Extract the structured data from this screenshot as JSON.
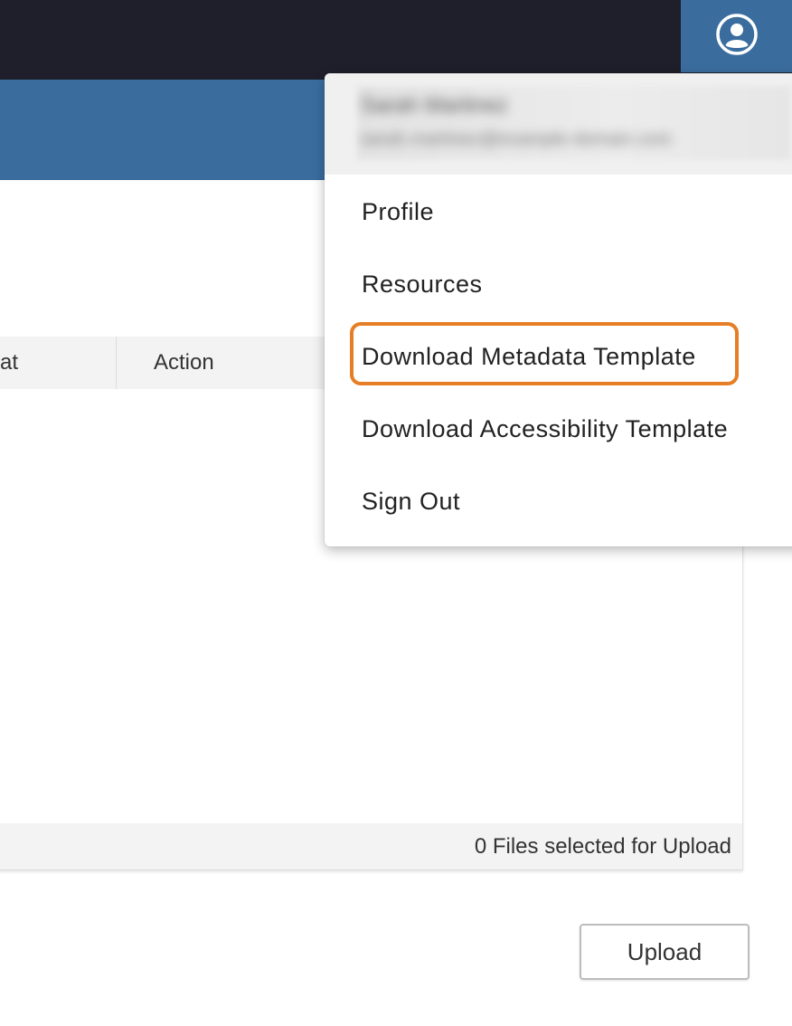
{
  "header": {
    "user_icon": "user-circle-icon"
  },
  "table": {
    "columns": [
      "at",
      "Action"
    ],
    "rows": [
      {},
      {},
      {},
      {},
      {}
    ],
    "footer_status": "0 Files selected for Upload"
  },
  "upload": {
    "label": "Upload"
  },
  "user_menu": {
    "name": "Sarah Martinez",
    "email": "sarah.martinez@example-domain.com",
    "items": [
      {
        "label": "Profile"
      },
      {
        "label": "Resources"
      },
      {
        "label": "Download Metadata Template"
      },
      {
        "label": "Download Accessibility Template"
      },
      {
        "label": "Sign Out"
      }
    ],
    "highlighted_item": "Download Metadata Template",
    "highlight_color": "#e57e25"
  },
  "colors": {
    "topbar": "#1f1f2b",
    "brand_blue": "#3a6d9e"
  }
}
